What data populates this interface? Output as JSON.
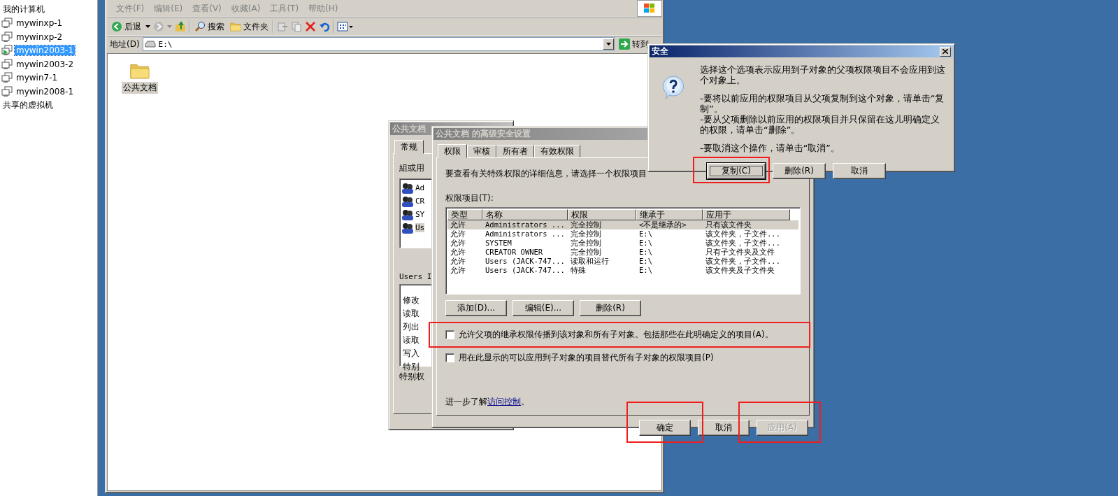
{
  "sidebar": {
    "items": [
      {
        "label": "我的计算机",
        "kind": "header",
        "selected": false
      },
      {
        "label": "mywinxp-1",
        "kind": "vm",
        "selected": false,
        "running": false
      },
      {
        "label": "mywinxp-2",
        "kind": "vm",
        "selected": false,
        "running": false
      },
      {
        "label": "mywin2003-1",
        "kind": "vm",
        "selected": true,
        "running": true
      },
      {
        "label": "mywin2003-2",
        "kind": "vm",
        "selected": false,
        "running": false
      },
      {
        "label": "mywin7-1",
        "kind": "vm",
        "selected": false,
        "running": false
      },
      {
        "label": "mywin2008-1",
        "kind": "vm",
        "selected": false,
        "running": false
      },
      {
        "label": "共享的虚拟机",
        "kind": "header",
        "selected": false
      }
    ]
  },
  "explorer": {
    "menu": [
      "文件(F)",
      "编辑(E)",
      "查看(V)",
      "收藏(A)",
      "工具(T)",
      "帮助(H)"
    ],
    "toolbar": {
      "back": "后退",
      "search": "搜索",
      "folders": "文件夹"
    },
    "address": {
      "label": "地址(D)",
      "value": "E:\\",
      "go": "转到"
    },
    "items": [
      {
        "label": "公共文档",
        "selected": true
      }
    ]
  },
  "properties": {
    "title": "公共文档",
    "tabs": [
      {
        "label": "常规",
        "selected": true
      }
    ],
    "group_label": "組或用",
    "principals": [
      {
        "label": "Ad",
        "selected": false
      },
      {
        "label": "CR",
        "selected": false
      },
      {
        "label": "SY",
        "selected": false
      },
      {
        "label": "Us",
        "selected": true
      }
    ],
    "permissions_label": "Users I",
    "permissions": [
      "修改",
      "读取",
      "列出",
      "读取",
      "写入",
      "特别"
    ],
    "special_label": "特别权"
  },
  "advanced": {
    "title": "公共文档 的高级安全设置",
    "tabs": [
      {
        "label": "权限",
        "selected": true
      },
      {
        "label": "审核",
        "selected": false
      },
      {
        "label": "所有者",
        "selected": false
      },
      {
        "label": "有效权限",
        "selected": false
      }
    ],
    "intro": "要查看有关特殊权限的详细信息，请选择一个权限项目",
    "list_label": "权限项目(T):",
    "table": {
      "columns": [
        "类型",
        "名称",
        "权限",
        "继承于",
        "应用于"
      ],
      "rows": [
        {
          "cells": [
            "允许",
            "Administrators ...",
            "完全控制",
            "<不是继承的>",
            "只有该文件夹"
          ],
          "selected": true
        },
        {
          "cells": [
            "允许",
            "Administrators ...",
            "完全控制",
            "E:\\",
            "该文件夹，子文件..."
          ],
          "selected": false
        },
        {
          "cells": [
            "允许",
            "SYSTEM",
            "完全控制",
            "E:\\",
            "该文件夹，子文件..."
          ],
          "selected": false
        },
        {
          "cells": [
            "允许",
            "CREATOR OWNER",
            "完全控制",
            "E:\\",
            "只有子文件夹及文件"
          ],
          "selected": false
        },
        {
          "cells": [
            "允许",
            "Users (JACK-747...",
            "读取和运行",
            "E:\\",
            "该文件夹，子文件..."
          ],
          "selected": false
        },
        {
          "cells": [
            "允许",
            "Users (JACK-747...",
            "特殊",
            "E:\\",
            "该文件夹及子文件夹"
          ],
          "selected": false
        }
      ]
    },
    "list_buttons": [
      "添加(D)...",
      "编辑(E)...",
      "删除(R)"
    ],
    "checkboxes": [
      {
        "label": "允许父项的继承权限传播到该对象和所有子对象。包括那些在此明确定义的项目(A)。",
        "checked": false,
        "highlighted": true
      },
      {
        "label": "用在此显示的可以应用到子对象的项目替代所有子对象的权限项目(P)",
        "checked": false,
        "highlighted": false
      }
    ],
    "learn_more": {
      "text": "进一步了解",
      "link": "访问控制",
      "end": "。"
    },
    "buttons": [
      {
        "label": "确定",
        "disabled": false,
        "highlighted": true
      },
      {
        "label": "取消",
        "disabled": false,
        "highlighted": false
      },
      {
        "label": "应用(A)",
        "disabled": true,
        "highlighted": true
      }
    ]
  },
  "security": {
    "title": "安全",
    "paragraphs": [
      [
        "选择这个选项表示应用到子对象的父项权限项目不会应用到这个对象上。"
      ],
      [
        "-要将以前应用的权限项目从父项复制到这个对象，请单击“复制”。",
        "-要从父项删除以前应用的权限项目并只保留在这儿明确定义的权限，请单击“删除”。"
      ],
      [
        "-要取消这个操作，请单击“取消”。"
      ]
    ],
    "buttons": [
      {
        "label": "复制(C)",
        "focused": true,
        "highlighted": true
      },
      {
        "label": "删除(R)",
        "focused": false,
        "highlighted": false
      },
      {
        "label": "取消",
        "focused": false,
        "highlighted": false
      }
    ]
  }
}
